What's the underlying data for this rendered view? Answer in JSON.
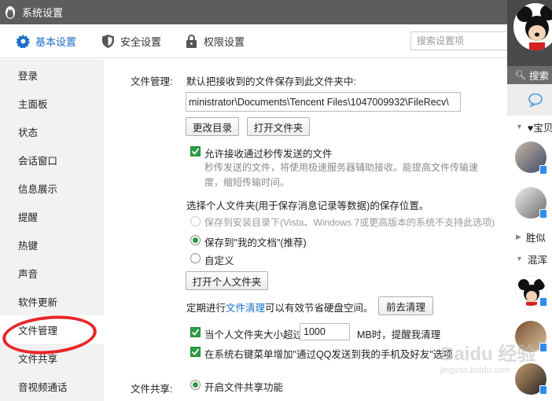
{
  "window": {
    "title": "系统设置"
  },
  "tabs": [
    {
      "label": "基本设置",
      "icon": "gear-icon"
    },
    {
      "label": "安全设置",
      "icon": "shield-icon"
    },
    {
      "label": "权限设置",
      "icon": "lock-icon"
    }
  ],
  "search": {
    "placeholder": "搜索设置项"
  },
  "sidebar": {
    "items": [
      {
        "label": "登录"
      },
      {
        "label": "主面板"
      },
      {
        "label": "状态"
      },
      {
        "label": "会话窗口"
      },
      {
        "label": "信息展示"
      },
      {
        "label": "提醒"
      },
      {
        "label": "热键"
      },
      {
        "label": "声音"
      },
      {
        "label": "软件更新"
      },
      {
        "label": "文件管理"
      },
      {
        "label": "文件共享"
      },
      {
        "label": "音视频通话"
      }
    ],
    "active_label": "文件管理"
  },
  "file_management": {
    "section_label": "文件管理:",
    "save_to_label": "默认把接收到的文件保存到此文件夹中:",
    "path_value": "ministrator\\Documents\\Tencent Files\\1047009932\\FileRecv\\",
    "change_dir_button": "更改目录",
    "open_folder_button": "打开文件夹",
    "allow_secpass_label": "允许接收通过秒传发送的文件",
    "allow_secpass_hint": "秒传发送的文件，将使用极速服务器辅助接收。能提高文件传输速度，缩短传输时间。",
    "personal_folder_label": "选择个人文件夹(用于保存消息记录等数据)的保存位置。",
    "radio_install_dir": "保存到安装目录下(Vista、Windows 7或更高版本的系统不支持此选项)",
    "radio_my_docs": "保存到\"我的文档\"(推荐)",
    "radio_custom": "自定义",
    "open_personal_button": "打开个人文件夹",
    "cleanup_prefix": "定期进行",
    "cleanup_link": "文件清理",
    "cleanup_suffix": "可以有效节省硬盘空间。",
    "cleanup_button": "前去清理",
    "size_limit_prefix": "当个人文件夹大小超过",
    "size_limit_value": "1000",
    "size_limit_suffix": "MB时，提醒我清理",
    "context_menu_label": "在系统右键菜单增加\"通过QQ发送到我的手机及好友\"选项"
  },
  "file_sharing": {
    "section_label": "文件共享:",
    "enable_label": "开启文件共享功能"
  },
  "qq_panel": {
    "search_label": "搜索",
    "groups": [
      {
        "label": "♥宝贝"
      },
      {
        "label": "胜似"
      },
      {
        "label": "混浑"
      }
    ]
  },
  "watermark": {
    "text": "Baidu 经验",
    "subtext": "jingyan.baidu.com"
  },
  "colors": {
    "titlebar": "#5d5d5d",
    "accent_blue": "#1a6fc9",
    "checkbox_green": "#2e9b45",
    "sidebar_bg": "#f2f2f2",
    "highlight_circle": "#e8262a"
  }
}
